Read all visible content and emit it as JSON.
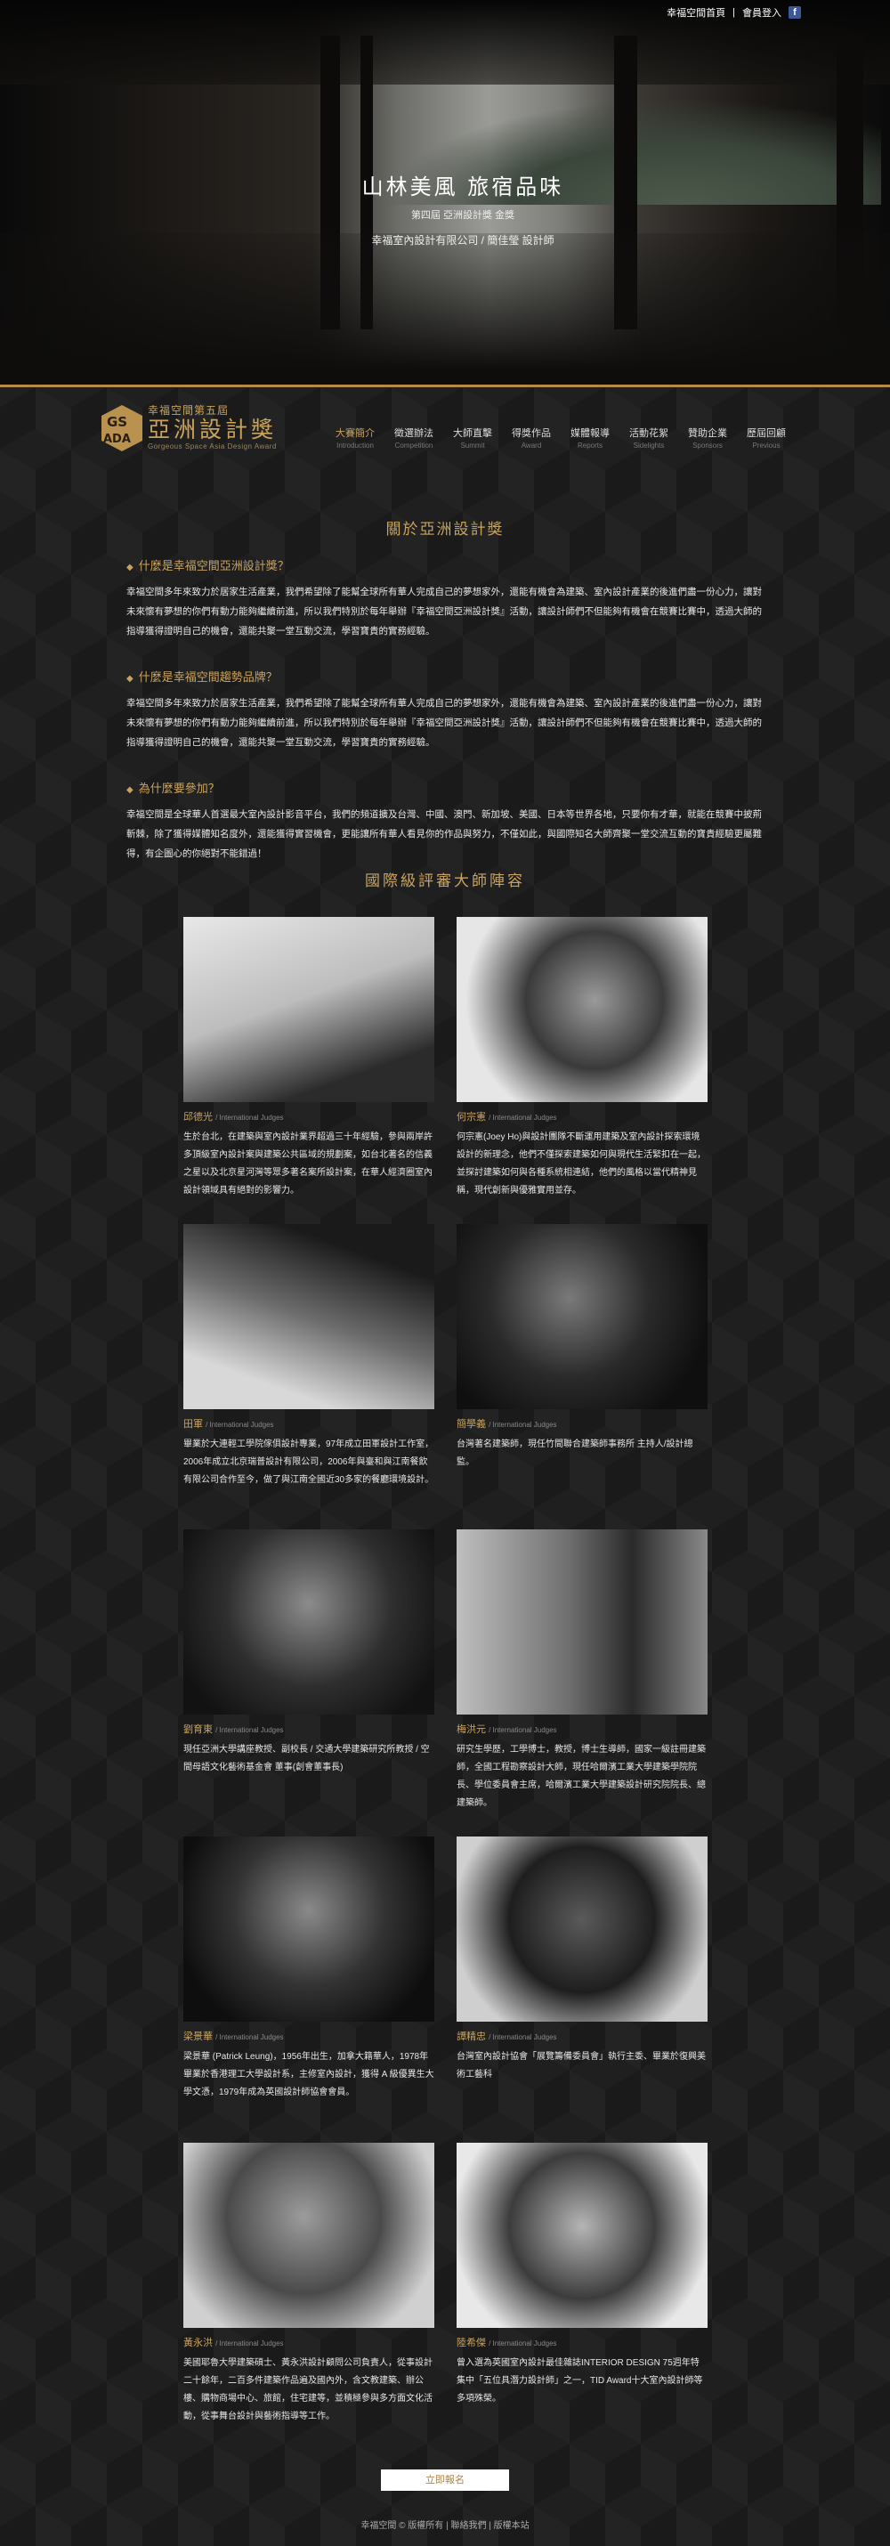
{
  "topbar": {
    "about_link": "幸福空間首頁",
    "separator": "|",
    "login_link": "會員登入",
    "fb_icon": "facebook-icon"
  },
  "hero": {
    "title": "山林美風 旅宿品味",
    "subtitle": "第四屆 亞洲設計獎 金獎",
    "credit": "幸福室內設計有限公司 / 簡佳瑩 設計師"
  },
  "logo": {
    "line1": "幸福空間第五屆",
    "line2": "亞洲設計獎",
    "line3": "Gorgeous Space Asia Design Award"
  },
  "nav": [
    {
      "zh": "大賽簡介",
      "en": "Introduction",
      "active": true
    },
    {
      "zh": "徵選辦法",
      "en": "Competition"
    },
    {
      "zh": "大師直擊",
      "en": "Summit"
    },
    {
      "zh": "得獎作品",
      "en": "Award"
    },
    {
      "zh": "媒體報導",
      "en": "Reports"
    },
    {
      "zh": "活動花絮",
      "en": "Sidelights"
    },
    {
      "zh": "贊助企業",
      "en": "Sponsors"
    },
    {
      "zh": "歷屆回顧",
      "en": "Previous"
    }
  ],
  "about": {
    "title": "關於亞洲設計獎",
    "q1": "什麼是幸福空間亞洲設計獎？",
    "p1": "幸福空間多年來致力於居家生活產業，我們希望除了能幫全球所有華人完成自己的夢想家外，還能有機會為建築、室內設計產業的後進們盡一份心力，讓對未來懷有夢想的你們有動力能夠繼續前進，所以我們特別於每年舉辦『幸福空間亞洲設計獎』活動，讓設計師們不但能夠有機會在競賽比賽中，透過大師的指導獲得證明自己的機會，還能共聚一堂互動交流，學習寶貴的實務經驗。",
    "q2": "什麼是幸福空間趨勢品牌？",
    "p2": "幸福空間多年來致力於居家生活產業，我們希望除了能幫全球所有華人完成自己的夢想家外，還能有機會為建築、室內設計產業的後進們盡一份心力，讓對未來懷有夢想的你們有動力能夠繼續前進，所以我們特別於每年舉辦『幸福空間亞洲設計獎』活動，讓設計師們不但能夠有機會在競賽比賽中，透過大師的指導獲得證明自己的機會，還能共聚一堂互動交流，學習寶貴的實務經驗。",
    "q3": "為什麼要參加？",
    "p3": "幸福空間是全球華人首選最大室內設計影音平台，我們的頻道擴及台灣、中國、澳門、新加坡、美國、日本等世界各地，只要你有才華，就能在競賽中披荊斬棘，除了獲得媒體知名度外，還能獲得實習機會，更能讓所有華人看見你的作品與努力，不僅如此，與國際知名大師齊聚一堂交流互動的寶貴經驗更屬難得，有企圖心的你絕對不能錯過！"
  },
  "judges_title": "國際級評審大師陣容",
  "judge_suffix": "/ International Judges",
  "judges": [
    {
      "name": "邱德光",
      "desc": "生於台北，在建築與室內設計業界超過三十年經驗，參與兩岸許多頂級室內設計案與建築公共區域的規劃案，如台北著名的信義之星以及北京星河灣等眾多著名案所設計案，在華人經濟圈室內設計領域具有絕對的影響力。"
    },
    {
      "name": "何宗憲",
      "desc": "何宗憲(Joey Ho)與設計團隊不斷運用建築及室內設計探索環境設計的新理念，他們不僅探索建築如何與現代生活緊扣在一起，並探討建築如何與各種系統相連結，他們的風格以當代精神見稱，現代創新與優雅實用並存。"
    },
    {
      "name": "田軍",
      "desc": "畢業於大連輕工學院傢俱設計專業，97年成立田軍設計工作室，2006年成立北京瑞普設計有限公司，2006年與臺和與江南餐飲有限公司合作至今，做了與江南全國近30多家的餐廳環境設計。"
    },
    {
      "name": "簡學義",
      "desc": "台灣著名建築師，現任竹間聯合建築師事務所 主持人/設計總監。"
    },
    {
      "name": "劉育東",
      "desc": "現任亞洲大學講座教授、副校長 / 交通大學建築研究所教授 / 空間母語文化藝術基金會 董事(創會董事長)"
    },
    {
      "name": "梅洪元",
      "desc": "研究生學歷，工學博士，教授，博士生導師，國家一級註冊建築師，全國工程勘察設計大師，現任哈爾濱工業大學建築學院院長、學位委員會主席，哈爾濱工業大學建築設計研究院院長、總建築師。"
    },
    {
      "name": "梁景華",
      "desc": "梁景華 (Patrick Leung)，1956年出生，加拿大籍華人，1978年畢業於香港理工大學設計系，主修室內設計，獲得 A 級優異生大學文憑，1979年成為英國設計師協會會員。"
    },
    {
      "name": "譚精忠",
      "desc": "台灣室內設計協會「展覽籌備委員會」執行主委、畢業於復興美術工藝科"
    },
    {
      "name": "黃永洪",
      "desc": "美國耶魯大學建築碩士、黃永洪設計顧問公司負責人，從事設計二十餘年，二百多件建築作品遍及國內外，含文教建築、辦公樓、購物商場中心、旅館，住宅建等，並積極參與多方面文化活動，從事舞台設計與藝術指導等工作。"
    },
    {
      "name": "陸希傑",
      "desc": "曾入選為英國室內設計最佳雜誌INTERIOR DESIGN 75週年特集中「五位具潛力設計師」之一，TID Award十大室內設計師等多項殊榮。"
    }
  ],
  "cta_label": "立即報名",
  "footer": {
    "text": "幸福空間 © 版權所有",
    "link1": "聯絡我們",
    "link2": "版權本站"
  }
}
